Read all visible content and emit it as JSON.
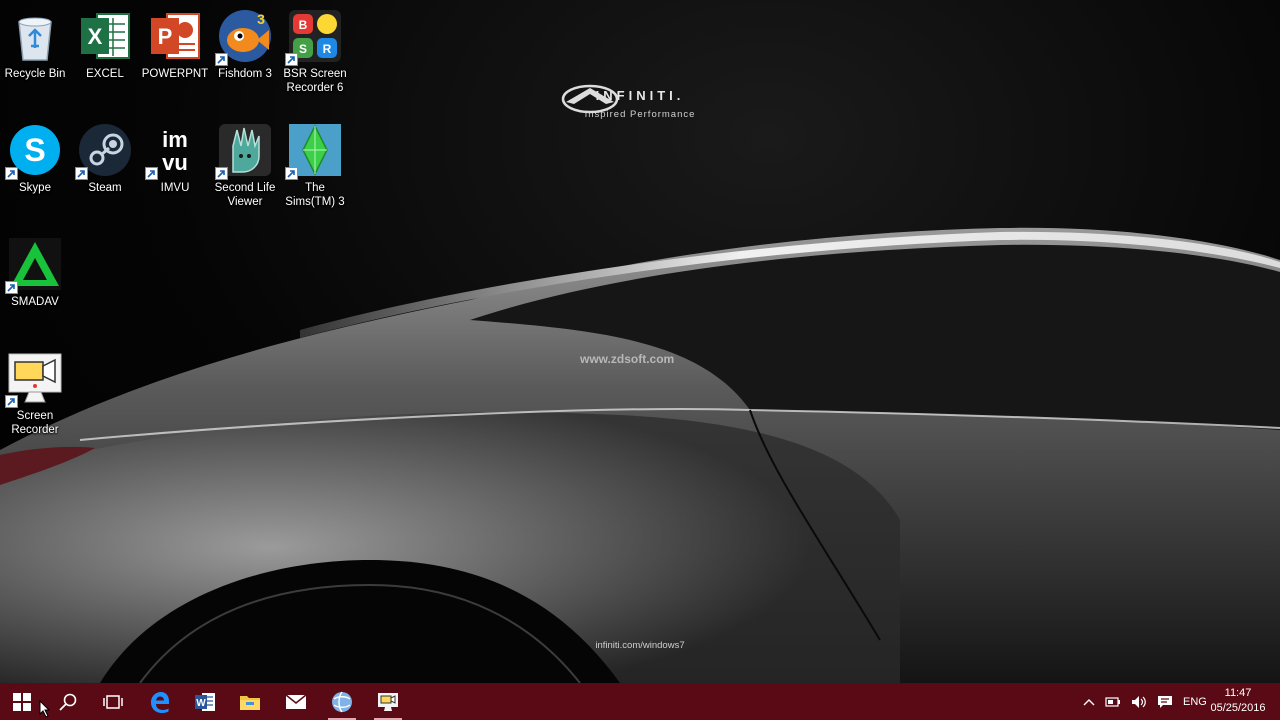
{
  "wallpaper": {
    "brand_name": "INFINITI.",
    "tagline": "Inspired Performance",
    "watermark": "www.zdsoft.com",
    "footer_url": "infiniti.com/windows7"
  },
  "desktop_icons": [
    {
      "label": "Recycle Bin",
      "icon": "recycle-bin-icon",
      "shortcut": false
    },
    {
      "label": "EXCEL",
      "icon": "excel-icon",
      "shortcut": false
    },
    {
      "label": "POWERPNT",
      "icon": "powerpoint-icon",
      "shortcut": false
    },
    {
      "label": "Fishdom 3",
      "icon": "fishdom-icon",
      "shortcut": true
    },
    {
      "label": "BSR Screen Recorder 6",
      "icon": "bsr-recorder-icon",
      "shortcut": true
    },
    {
      "label": "Skype",
      "icon": "skype-icon",
      "shortcut": true
    },
    {
      "label": "Steam",
      "icon": "steam-icon",
      "shortcut": true
    },
    {
      "label": "IMVU",
      "icon": "imvu-icon",
      "shortcut": true
    },
    {
      "label": "Second Life Viewer",
      "icon": "second-life-icon",
      "shortcut": true
    },
    {
      "label": "The Sims(TM) 3",
      "icon": "sims-icon",
      "shortcut": true
    },
    {
      "label": "SMADAV",
      "icon": "smadav-icon",
      "shortcut": true
    },
    {
      "label": "Screen Recorder",
      "icon": "screen-recorder-icon",
      "shortcut": true
    }
  ],
  "taskbar": {
    "color": "#5a0a14",
    "buttons": [
      {
        "name": "start-button",
        "icon": "windows-logo-icon"
      },
      {
        "name": "search-button",
        "icon": "search-icon"
      },
      {
        "name": "task-view-button",
        "icon": "task-view-icon"
      },
      {
        "name": "edge-button",
        "icon": "edge-icon"
      },
      {
        "name": "word-button",
        "icon": "word-icon"
      },
      {
        "name": "file-explorer-button",
        "icon": "folder-icon"
      },
      {
        "name": "mail-button",
        "icon": "mail-icon"
      },
      {
        "name": "browser-button",
        "icon": "globe-icon"
      },
      {
        "name": "screen-recorder-taskbar-button",
        "icon": "screen-recorder-icon"
      }
    ],
    "tray": {
      "language": "ENG",
      "time": "11:47",
      "date": "05/25/2016"
    }
  }
}
